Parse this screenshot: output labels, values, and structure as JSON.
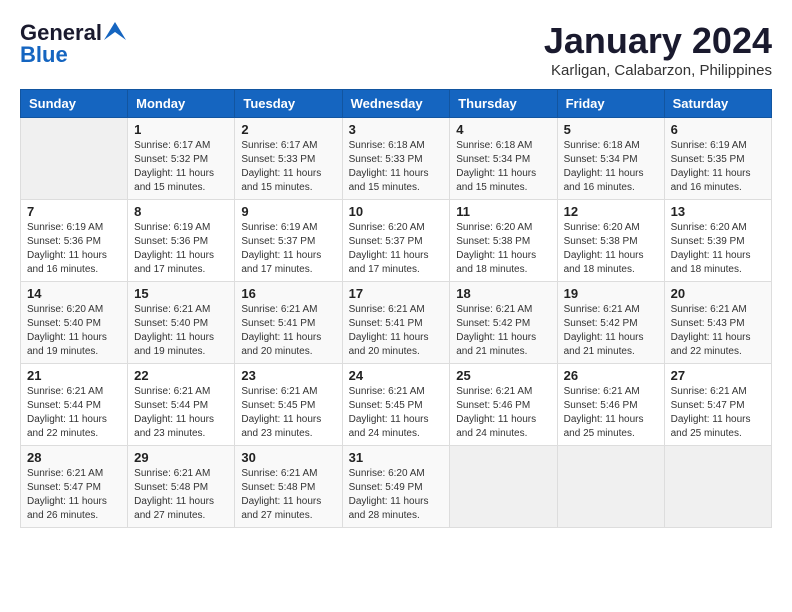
{
  "header": {
    "logo_line1": "General",
    "logo_line2": "Blue",
    "month": "January 2024",
    "location": "Karligan, Calabarzon, Philippines"
  },
  "weekdays": [
    "Sunday",
    "Monday",
    "Tuesday",
    "Wednesday",
    "Thursday",
    "Friday",
    "Saturday"
  ],
  "weeks": [
    [
      {
        "day": "",
        "info": ""
      },
      {
        "day": "1",
        "info": "Sunrise: 6:17 AM\nSunset: 5:32 PM\nDaylight: 11 hours\nand 15 minutes."
      },
      {
        "day": "2",
        "info": "Sunrise: 6:17 AM\nSunset: 5:33 PM\nDaylight: 11 hours\nand 15 minutes."
      },
      {
        "day": "3",
        "info": "Sunrise: 6:18 AM\nSunset: 5:33 PM\nDaylight: 11 hours\nand 15 minutes."
      },
      {
        "day": "4",
        "info": "Sunrise: 6:18 AM\nSunset: 5:34 PM\nDaylight: 11 hours\nand 15 minutes."
      },
      {
        "day": "5",
        "info": "Sunrise: 6:18 AM\nSunset: 5:34 PM\nDaylight: 11 hours\nand 16 minutes."
      },
      {
        "day": "6",
        "info": "Sunrise: 6:19 AM\nSunset: 5:35 PM\nDaylight: 11 hours\nand 16 minutes."
      }
    ],
    [
      {
        "day": "7",
        "info": "Sunrise: 6:19 AM\nSunset: 5:36 PM\nDaylight: 11 hours\nand 16 minutes."
      },
      {
        "day": "8",
        "info": "Sunrise: 6:19 AM\nSunset: 5:36 PM\nDaylight: 11 hours\nand 17 minutes."
      },
      {
        "day": "9",
        "info": "Sunrise: 6:19 AM\nSunset: 5:37 PM\nDaylight: 11 hours\nand 17 minutes."
      },
      {
        "day": "10",
        "info": "Sunrise: 6:20 AM\nSunset: 5:37 PM\nDaylight: 11 hours\nand 17 minutes."
      },
      {
        "day": "11",
        "info": "Sunrise: 6:20 AM\nSunset: 5:38 PM\nDaylight: 11 hours\nand 18 minutes."
      },
      {
        "day": "12",
        "info": "Sunrise: 6:20 AM\nSunset: 5:38 PM\nDaylight: 11 hours\nand 18 minutes."
      },
      {
        "day": "13",
        "info": "Sunrise: 6:20 AM\nSunset: 5:39 PM\nDaylight: 11 hours\nand 18 minutes."
      }
    ],
    [
      {
        "day": "14",
        "info": "Sunrise: 6:20 AM\nSunset: 5:40 PM\nDaylight: 11 hours\nand 19 minutes."
      },
      {
        "day": "15",
        "info": "Sunrise: 6:21 AM\nSunset: 5:40 PM\nDaylight: 11 hours\nand 19 minutes."
      },
      {
        "day": "16",
        "info": "Sunrise: 6:21 AM\nSunset: 5:41 PM\nDaylight: 11 hours\nand 20 minutes."
      },
      {
        "day": "17",
        "info": "Sunrise: 6:21 AM\nSunset: 5:41 PM\nDaylight: 11 hours\nand 20 minutes."
      },
      {
        "day": "18",
        "info": "Sunrise: 6:21 AM\nSunset: 5:42 PM\nDaylight: 11 hours\nand 21 minutes."
      },
      {
        "day": "19",
        "info": "Sunrise: 6:21 AM\nSunset: 5:42 PM\nDaylight: 11 hours\nand 21 minutes."
      },
      {
        "day": "20",
        "info": "Sunrise: 6:21 AM\nSunset: 5:43 PM\nDaylight: 11 hours\nand 22 minutes."
      }
    ],
    [
      {
        "day": "21",
        "info": "Sunrise: 6:21 AM\nSunset: 5:44 PM\nDaylight: 11 hours\nand 22 minutes."
      },
      {
        "day": "22",
        "info": "Sunrise: 6:21 AM\nSunset: 5:44 PM\nDaylight: 11 hours\nand 23 minutes."
      },
      {
        "day": "23",
        "info": "Sunrise: 6:21 AM\nSunset: 5:45 PM\nDaylight: 11 hours\nand 23 minutes."
      },
      {
        "day": "24",
        "info": "Sunrise: 6:21 AM\nSunset: 5:45 PM\nDaylight: 11 hours\nand 24 minutes."
      },
      {
        "day": "25",
        "info": "Sunrise: 6:21 AM\nSunset: 5:46 PM\nDaylight: 11 hours\nand 24 minutes."
      },
      {
        "day": "26",
        "info": "Sunrise: 6:21 AM\nSunset: 5:46 PM\nDaylight: 11 hours\nand 25 minutes."
      },
      {
        "day": "27",
        "info": "Sunrise: 6:21 AM\nSunset: 5:47 PM\nDaylight: 11 hours\nand 25 minutes."
      }
    ],
    [
      {
        "day": "28",
        "info": "Sunrise: 6:21 AM\nSunset: 5:47 PM\nDaylight: 11 hours\nand 26 minutes."
      },
      {
        "day": "29",
        "info": "Sunrise: 6:21 AM\nSunset: 5:48 PM\nDaylight: 11 hours\nand 27 minutes."
      },
      {
        "day": "30",
        "info": "Sunrise: 6:21 AM\nSunset: 5:48 PM\nDaylight: 11 hours\nand 27 minutes."
      },
      {
        "day": "31",
        "info": "Sunrise: 6:20 AM\nSunset: 5:49 PM\nDaylight: 11 hours\nand 28 minutes."
      },
      {
        "day": "",
        "info": ""
      },
      {
        "day": "",
        "info": ""
      },
      {
        "day": "",
        "info": ""
      }
    ]
  ]
}
